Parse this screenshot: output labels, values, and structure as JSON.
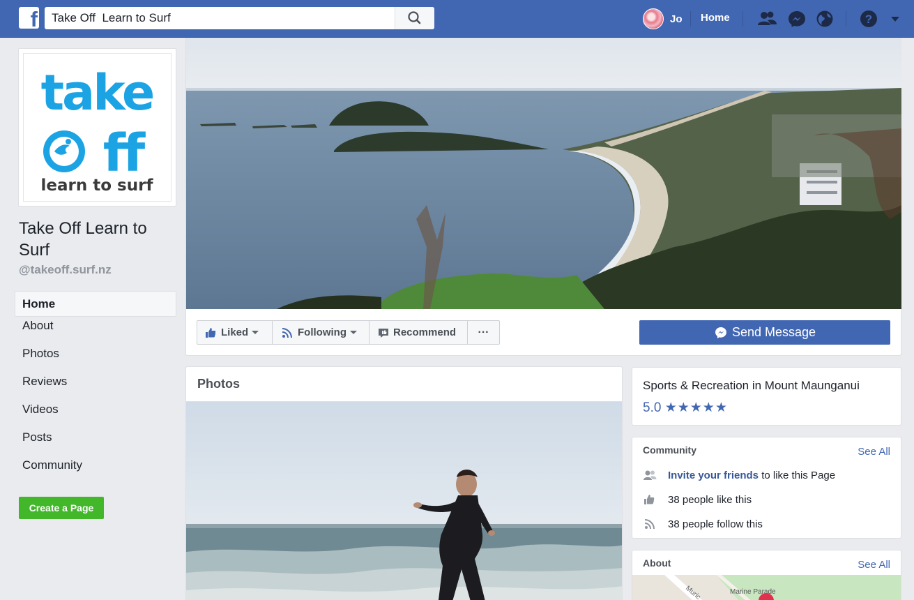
{
  "topbar": {
    "brand_letter": "f",
    "search_value": "Take Off  Learn to Surf",
    "user_name": "Jo",
    "home_label": "Home"
  },
  "page": {
    "logo_text": {
      "line1": "take",
      "line2": "ff",
      "line3": "learn to surf"
    },
    "name": "Take Off Learn to Surf",
    "handle": "@takeoff.surf.nz"
  },
  "nav": {
    "items": [
      {
        "label": "Home",
        "active": true
      },
      {
        "label": "About"
      },
      {
        "label": "Photos"
      },
      {
        "label": "Reviews"
      },
      {
        "label": "Videos"
      },
      {
        "label": "Posts"
      },
      {
        "label": "Community"
      }
    ],
    "create_page_label": "Create a Page"
  },
  "actions": {
    "liked_label": "Liked",
    "following_label": "Following",
    "recommend_label": "Recommend",
    "more_label": "···",
    "send_message_label": "Send Message"
  },
  "photos": {
    "title": "Photos"
  },
  "info": {
    "category": "Sports & Recreation in Mount Maunganui",
    "rating": "5.0",
    "stars": "★★★★★",
    "rating_value": 5
  },
  "community": {
    "title": "Community",
    "see_all": "See All",
    "invite_link": "Invite your friends",
    "invite_rest": " to like this Page",
    "likes": "38 people like this",
    "follows": "38 people follow this"
  },
  "about": {
    "title": "About",
    "see_all": "See All",
    "map_street1": "Muric",
    "map_street2": "Marine Parade"
  },
  "colors": {
    "brand_blue": "#4267b2",
    "logo_cyan": "#1ba3e4",
    "create_green": "#42b72a",
    "link_blue": "#365899"
  }
}
